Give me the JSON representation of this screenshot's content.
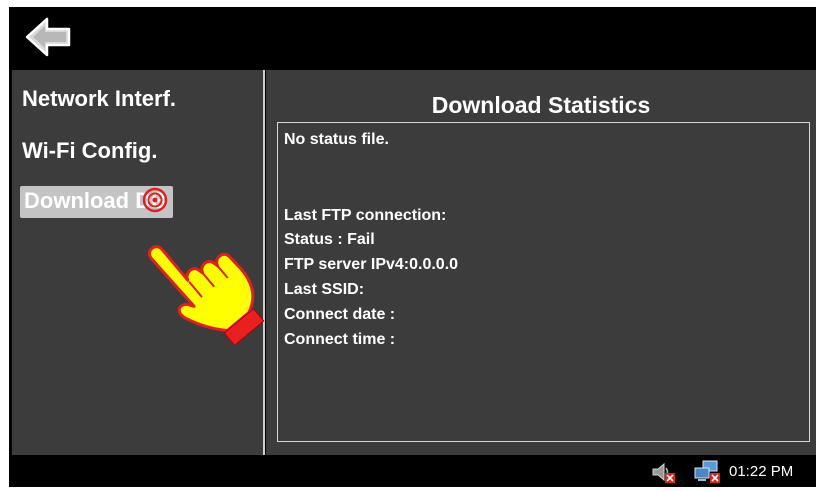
{
  "topbar": {
    "back_icon": "back-arrow-icon"
  },
  "sidebar": {
    "items": [
      {
        "label": "Network Interf.",
        "active": false
      },
      {
        "label": "Wi-Fi Config.",
        "active": false
      },
      {
        "label": "Download DB",
        "active": true
      }
    ]
  },
  "main": {
    "title": "Download Statistics",
    "status_lines": [
      "No status file.",
      "Last FTP connection:",
      "Status : Fail",
      "FTP server IPv4:0.0.0.0",
      "Last SSID:",
      "Connect date :",
      "Connect time :"
    ]
  },
  "taskbar": {
    "icons": [
      "speaker-muted-icon",
      "network-disconnected-icon"
    ],
    "clock": "01:22 PM"
  },
  "overlay": {
    "icon": "pointing-hand-icon"
  },
  "colors": {
    "panel_bg": "#3c3c3c",
    "active_item_bg": "#c4c4c4",
    "error_badge": "#e02020",
    "hand_fill": "#ffff00",
    "hand_cuff": "#e82020"
  }
}
